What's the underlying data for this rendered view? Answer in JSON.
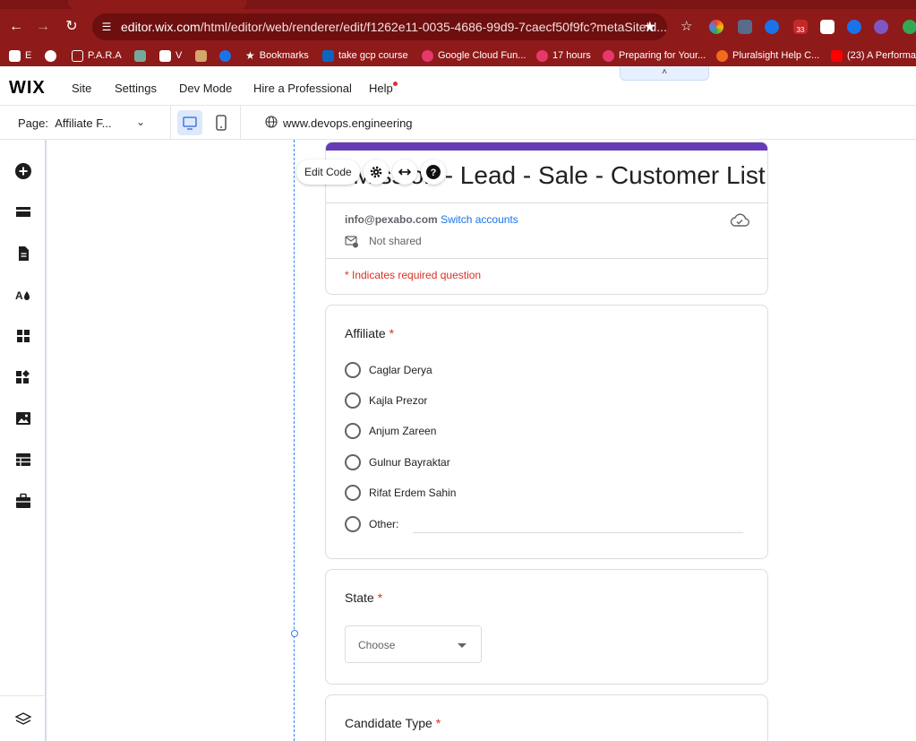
{
  "browser": {
    "url_host": "editor.wix.com",
    "url_path": "/html/editor/web/renderer/edit/f1262e11-0035-4686-99d9-7caecf50f9fc?metaSiteId...",
    "bookmarks": [
      "E",
      "P.A.R.A",
      "V",
      "Bookmarks",
      "take gcp course",
      "Google Cloud Fun...",
      "17 hours",
      "Preparing for Your...",
      "Pluralsight Help C...",
      "(23) A Performa"
    ],
    "ext_badge_1": "33"
  },
  "wix": {
    "logo": "WIX",
    "menu": [
      "Site",
      "Settings",
      "Dev Mode",
      "Hire a Professional",
      "Help"
    ],
    "collapse_glyph": "˄",
    "page_label": "Page:",
    "page_name": "Affiliate F...",
    "domain": "www.devops.engineering",
    "edit_code": "Edit Code"
  },
  "form": {
    "title": "Mission - Lead - Sale - Customer List",
    "account_email": "info@pexabo.com",
    "switch_accounts": "Switch accounts",
    "not_shared": "Not shared",
    "required_note": "* Indicates required question",
    "affiliate_q": "Affiliate",
    "affiliate_options": [
      "Caglar Derya",
      "Kajla Prezor",
      "Anjum Zareen",
      "Gulnur Bayraktar",
      "Rifat Erdem Sahin",
      "Other:"
    ],
    "state_q": "State",
    "state_placeholder": "Choose",
    "candidate_q": "Candidate Type",
    "required_mark": "*"
  },
  "colors": {
    "chrome": "#8e1a1a",
    "form_accent": "#673ab7",
    "link": "#1a73e8",
    "required": "#d93025",
    "selection_guide": "#3b7ded"
  }
}
